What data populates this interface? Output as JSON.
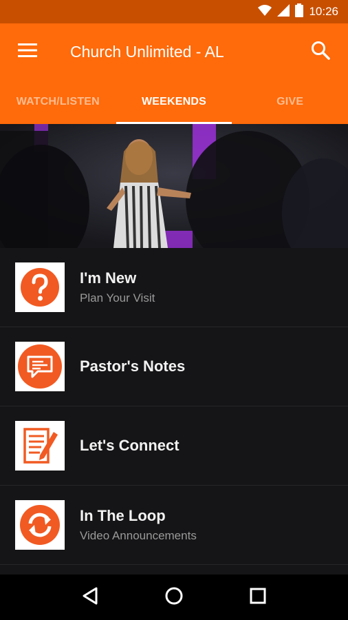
{
  "status_bar": {
    "time": "10:26",
    "icons": [
      "wifi-icon",
      "signal-icon",
      "battery-icon"
    ]
  },
  "app_bar": {
    "title": "Church Unlimited - AL",
    "menu_icon": "hamburger-menu-icon",
    "search_icon": "search-icon"
  },
  "tabs": [
    {
      "label": "WATCH/LISTEN",
      "active": false
    },
    {
      "label": "WEEKENDS",
      "active": true
    },
    {
      "label": "GIVE",
      "active": false
    }
  ],
  "list": [
    {
      "title": "I'm New",
      "subtitle": "Plan Your Visit",
      "icon": "question-mark-icon"
    },
    {
      "title": "Pastor's Notes",
      "subtitle": "",
      "icon": "speech-bubble-notes-icon"
    },
    {
      "title": "Let's Connect",
      "subtitle": "",
      "icon": "form-pencil-icon"
    },
    {
      "title": "In The Loop",
      "subtitle": "Video Announcements",
      "icon": "refresh-arrows-icon"
    }
  ],
  "nav_bar": {
    "icons": [
      "back-icon",
      "home-icon",
      "recents-icon"
    ]
  },
  "colors": {
    "primary": "#ff6a0a",
    "status_bar": "#c84f00",
    "background": "#151517",
    "accent_icon": "#f15a22"
  }
}
